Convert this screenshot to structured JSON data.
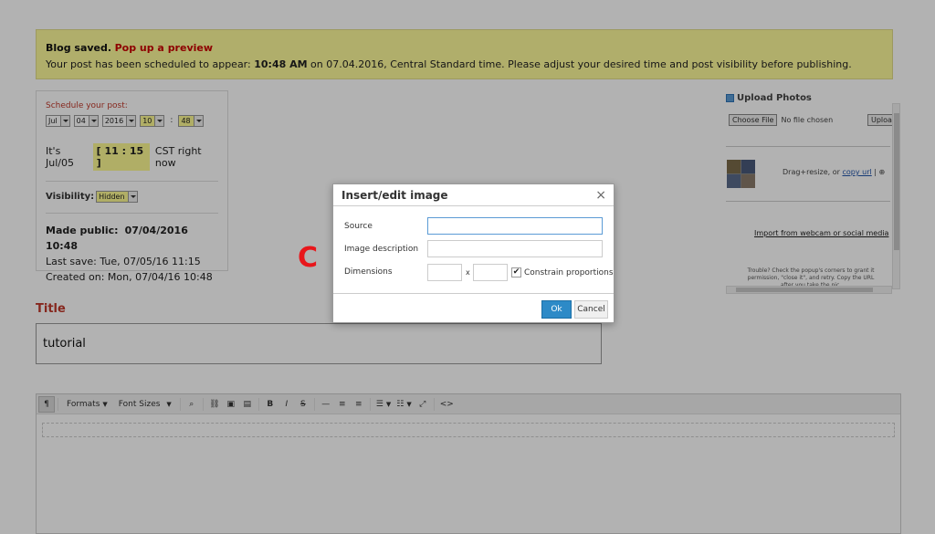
{
  "notice": {
    "saved_label": "Blog saved.",
    "preview_link": "Pop up a preview",
    "text_before": "Your post has been scheduled to appear:",
    "time": "10:48 AM",
    "text_after": "on 07.04.2016, Central Standard time. Please adjust your desired time and post visibility before publishing."
  },
  "schedule": {
    "label": "Schedule your post:",
    "month": "Jul",
    "day": "04",
    "year": "2016",
    "hour": "10",
    "colon": ":",
    "minute": "48",
    "now_prefix": "It's Jul/05",
    "now_clock": "[ 11 : 15 ]",
    "now_suffix": "CST right now",
    "visibility_label": "Visibility:",
    "visibility_value": "Hidden",
    "made_public_label": "Made public:",
    "made_public_value": "07/04/2016 10:48",
    "last_save": "Last save:   Tue, 07/05/16 11:15",
    "created_on": "Created on:   Mon, 07/04/16 10:48"
  },
  "title_field": {
    "label": "Title",
    "value": "tutorial"
  },
  "toolbar": {
    "paragraph": "¶",
    "formats": "Formats",
    "font_sizes": "Font Sizes",
    "bold": "B",
    "italic": "I",
    "strike": "S",
    "code": "<>"
  },
  "upload": {
    "heading": "Upload Photos",
    "choose_file": "Choose File",
    "no_file": "No file chosen",
    "upload_btn": "Uploa",
    "drag_text": "Drag+resize, or",
    "copy_url": "copy url",
    "import_link": "Import from webcam or social media",
    "trouble": "Trouble? Check the popup's corners to grant it permission, \"close it\", and retry. Copy the URL after you take the pic."
  },
  "overlay_letter": "C",
  "dialog": {
    "title": "Insert/edit image",
    "close": "×",
    "source_label": "Source",
    "source_value": "",
    "description_label": "Image description",
    "description_value": "",
    "dimensions_label": "Dimensions",
    "width_value": "",
    "height_value": "",
    "x_sep": "x",
    "constrain_label": "Constrain proportions",
    "constrain_checked": "✔",
    "ok": "Ok",
    "cancel": "Cancel"
  }
}
